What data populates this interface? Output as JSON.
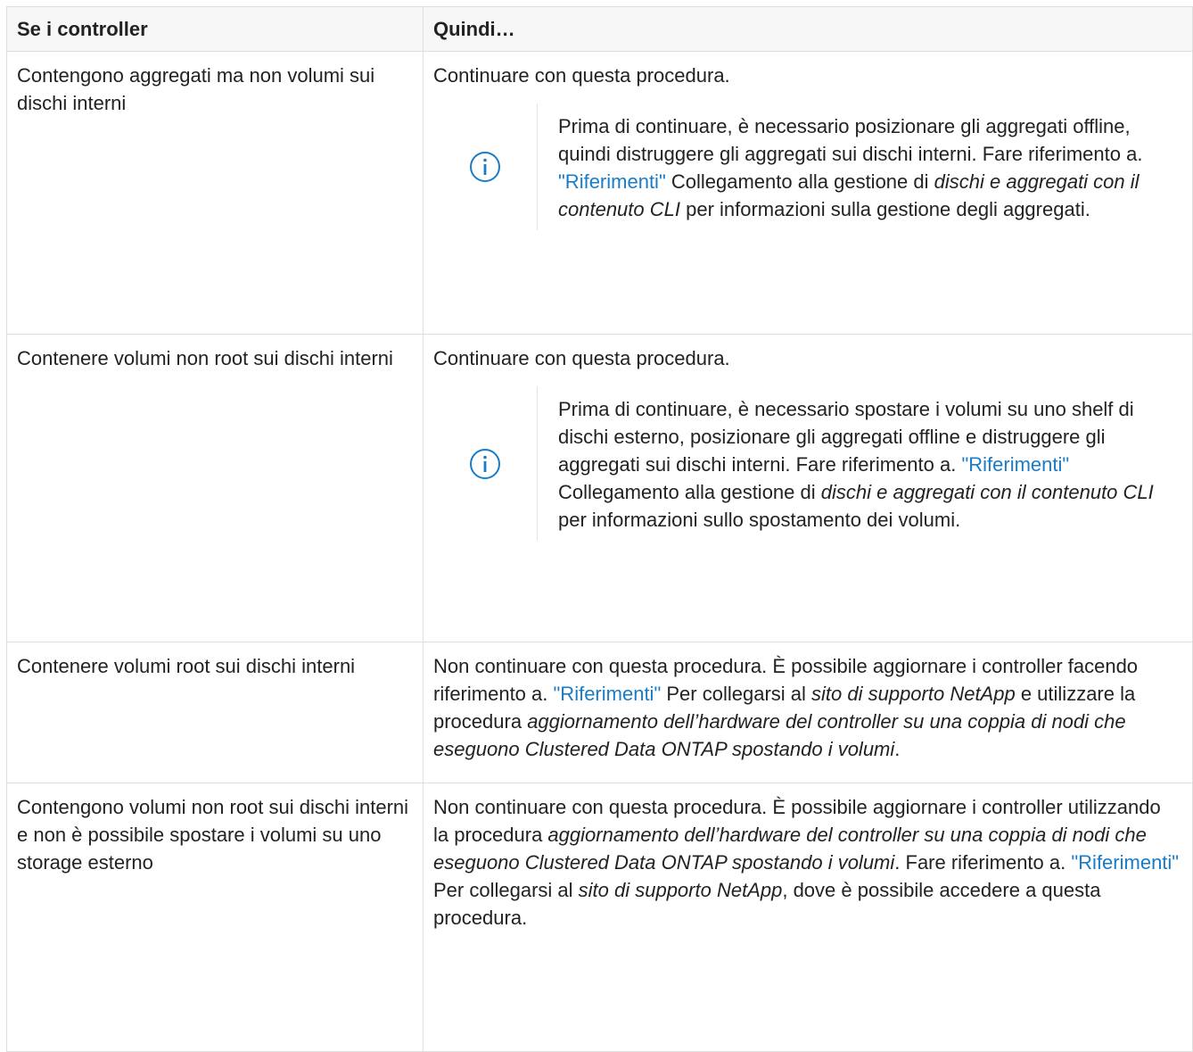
{
  "table": {
    "headers": [
      "Se i controller",
      "Quindi…"
    ],
    "rows": [
      {
        "condition": "Contengono aggregati ma non volumi sui dischi interni",
        "action": "Continuare con questa procedura.",
        "note": {
          "icon": "info-icon",
          "text1": "Prima di continuare, è necessario posizionare gli aggregati offline, quindi distruggere gli aggregati sui dischi interni. Fare riferimento a. ",
          "link": "\"Riferimenti\"",
          "text2": " Collegamento alla gestione di ",
          "em1": "dischi e aggregati con il contenuto CLI",
          "text3": " per informazioni sulla gestione degli aggregati."
        }
      },
      {
        "condition": "Contenere volumi non root sui dischi interni",
        "action": "Continuare con questa procedura.",
        "note": {
          "icon": "info-icon",
          "text1": "Prima di continuare, è necessario spostare i volumi su uno shelf di dischi esterno, posizionare gli aggregati offline e distruggere gli aggregati sui dischi interni. Fare riferimento a. ",
          "link": "\"Riferimenti\"",
          "text2": " Collegamento alla gestione di ",
          "em1": "dischi e aggregati con il contenuto CLI",
          "text3": " per informazioni sullo spostamento dei volumi."
        }
      },
      {
        "condition": "Contenere volumi root sui dischi interni",
        "action": {
          "text1": "Non continuare con questa procedura. È possibile aggiornare i controller facendo riferimento a. ",
          "link": "\"Riferimenti\"",
          "text2": " Per collegarsi al ",
          "em1": "sito di supporto NetApp",
          "text3": " e utilizzare la procedura ",
          "em2": "aggiornamento dell’hardware del controller su una coppia di nodi che eseguono Clustered Data ONTAP spostando i volumi",
          "text4": "."
        }
      },
      {
        "condition": "Contengono volumi non root sui dischi interni e non è possibile spostare i volumi su uno storage esterno",
        "action": {
          "text1": "Non continuare con questa procedura. È possibile aggiornare i controller utilizzando la procedura ",
          "em1": "aggiornamento dell’hardware del controller su una coppia di nodi che eseguono Clustered Data ONTAP spostando i volumi",
          "text2": ". Fare riferimento a. ",
          "link": "\"Riferimenti\"",
          "text3": " Per collegarsi al ",
          "em2": "sito di supporto NetApp",
          "text4": ", dove è possibile accedere a questa procedura."
        }
      }
    ]
  },
  "colors": {
    "link": "#1a7bc6",
    "header_bg": "#f7f7f8",
    "border": "#dedede",
    "icon": "#1a7bc6"
  }
}
